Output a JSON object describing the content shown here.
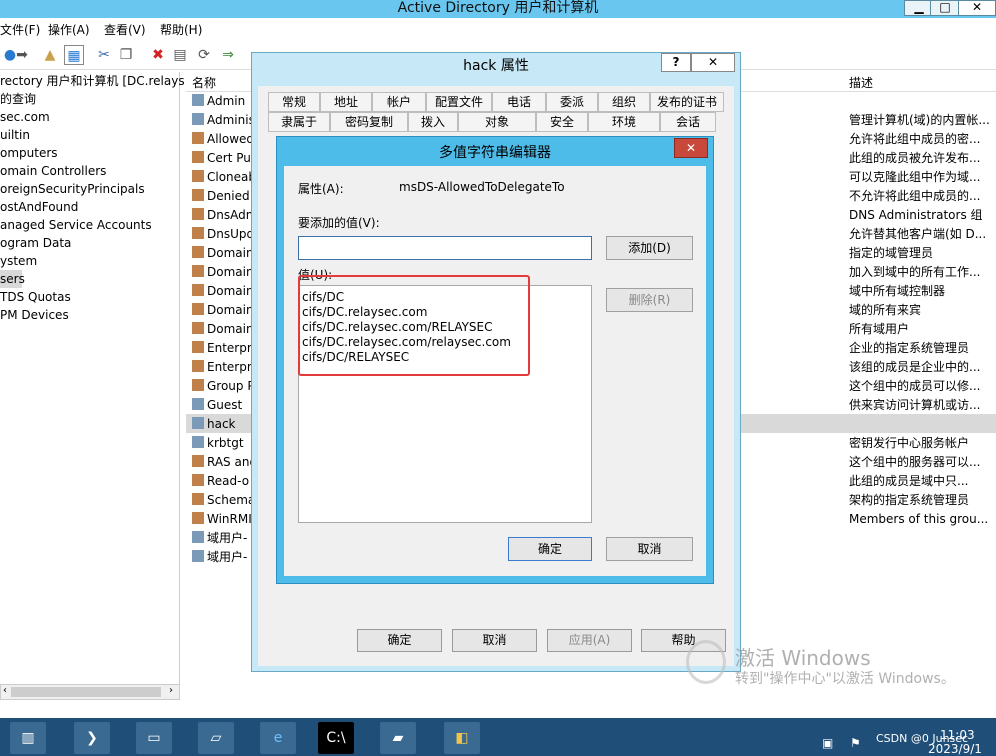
{
  "window": {
    "title": "Active Directory 用户和计算机",
    "minimize": "▁",
    "maximize": "□",
    "close": "✕"
  },
  "menu": [
    "文件(F)",
    "操作(A)",
    "查看(V)",
    "帮助(H)"
  ],
  "tree": [
    "rectory 用户和计算机 [DC.relays",
    "的查询",
    "sec.com",
    "uiltin",
    "omputers",
    "omain Controllers",
    "oreignSecurityPrincipals",
    "ostAndFound",
    "anaged Service Accounts",
    "ogram Data",
    "ystem",
    "sers",
    "TDS Quotas",
    "PM Devices"
  ],
  "list": {
    "col_name": "名称",
    "col_desc": "描述",
    "names": [
      "Admin",
      "Adminis",
      "Allowed",
      "Cert Pul",
      "Cloneab",
      "Denied",
      "DnsAdm",
      "DnsUpd",
      "Domain",
      "Domain",
      "Domain",
      "Domain",
      "Domain",
      "Enterpr",
      "Enterpr",
      "Group P",
      "Guest",
      "hack",
      "krbtgt",
      "RAS and",
      "Read-o",
      "Schema",
      "WinRMI",
      "域用户-",
      "域用户-"
    ],
    "descs": [
      "",
      "管理计算机(域)的内置帐...",
      "允许将此组中成员的密...",
      "此组的成员被允许发布...",
      "可以克隆此组中作为域...",
      "不允许将此组中成员的...",
      "DNS Administrators 组",
      "允许替其他客户端(如 D...",
      "指定的域管理员",
      "加入到域中的所有工作...",
      "域中所有域控制器",
      "域的所有来宾",
      "所有域用户",
      "企业的指定系统管理员",
      "该组的成员是企业中的...",
      "这个组中的成员可以修...",
      "供来宾访问计算机或访...",
      "",
      "密钥发行中心服务帐户",
      "这个组中的服务器可以...",
      "此组的成员是域中只...",
      "架构的指定系统管理员",
      "Members of this grou..."
    ]
  },
  "prop_dialog": {
    "title": "hack 属性",
    "help": "?",
    "close": "✕",
    "tabs_row1": [
      "常规",
      "地址",
      "帐户",
      "配置文件",
      "电话",
      "委派",
      "组织",
      "发布的证书"
    ],
    "tabs_row2": [
      "隶属于",
      "密码复制",
      "拨入",
      "对象",
      "安全",
      "环境",
      "会话"
    ],
    "ok": "确定",
    "cancel": "取消",
    "apply": "应用(A)",
    "helpbtn": "帮助"
  },
  "mv_dialog": {
    "title": "多值字符串编辑器",
    "close": "✕",
    "attr_label": "属性(A):",
    "attr_value": "msDS-AllowedToDelegateTo",
    "add_label": "要添加的值(V):",
    "add_input": "",
    "add_button": "添加(D)",
    "values_label": "值(U):",
    "values": [
      "cifs/DC",
      "cifs/DC.relaysec.com",
      "cifs/DC.relaysec.com/RELAYSEC",
      "cifs/DC.relaysec.com/relaysec.com",
      "cifs/DC/RELAYSEC"
    ],
    "remove_button": "删除(R)",
    "ok": "确定",
    "cancel": "取消"
  },
  "watermark": {
    "line1": "激活 Windows",
    "line2": "转到\"操作中心\"以激活 Windows。"
  },
  "taskbar": {
    "time": "11:03",
    "date": "2023/9/1",
    "tray_text": "CSDN @0 Junsec"
  },
  "colors": {
    "highlight": "#e33a3a",
    "accent": "#4dbce8",
    "selected_row": "#d9d9d9"
  }
}
